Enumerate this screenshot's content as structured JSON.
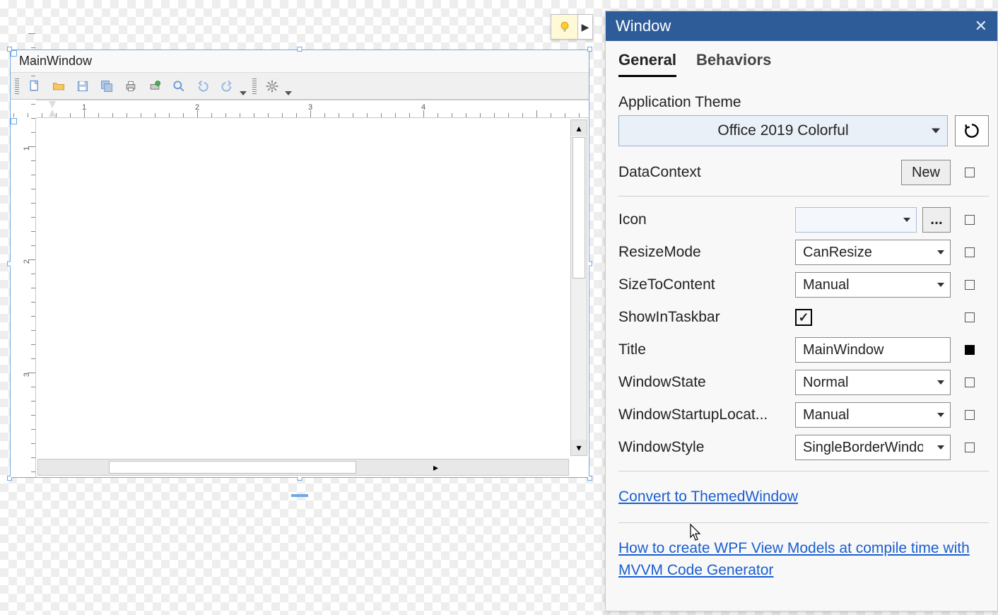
{
  "designer": {
    "window_title": "MainWindow",
    "ruler_labels_h": [
      1,
      2,
      3,
      4
    ],
    "ruler_labels_v": [
      1,
      2,
      3
    ]
  },
  "panel": {
    "title": "Window",
    "tabs": {
      "general": "General",
      "behaviors": "Behaviors"
    },
    "theme_label": "Application Theme",
    "theme_value": "Office 2019 Colorful",
    "datacontext_label": "DataContext",
    "new_button": "New",
    "props": {
      "icon": {
        "label": "Icon",
        "value": "",
        "ellipsis": "..."
      },
      "resize": {
        "label": "ResizeMode",
        "value": "CanResize"
      },
      "size": {
        "label": "SizeToContent",
        "value": "Manual"
      },
      "taskbar": {
        "label": "ShowInTaskbar",
        "checked": true
      },
      "title": {
        "label": "Title",
        "value": "MainWindow"
      },
      "state": {
        "label": "WindowState",
        "value": "Normal"
      },
      "startup": {
        "label": "WindowStartupLocat...",
        "value": "Manual"
      },
      "style": {
        "label": "WindowStyle",
        "value": "SingleBorderWindow"
      }
    },
    "link1": "Convert to ThemedWindow",
    "link2": "How to create WPF View Models at compile time with MVVM Code Generator"
  }
}
